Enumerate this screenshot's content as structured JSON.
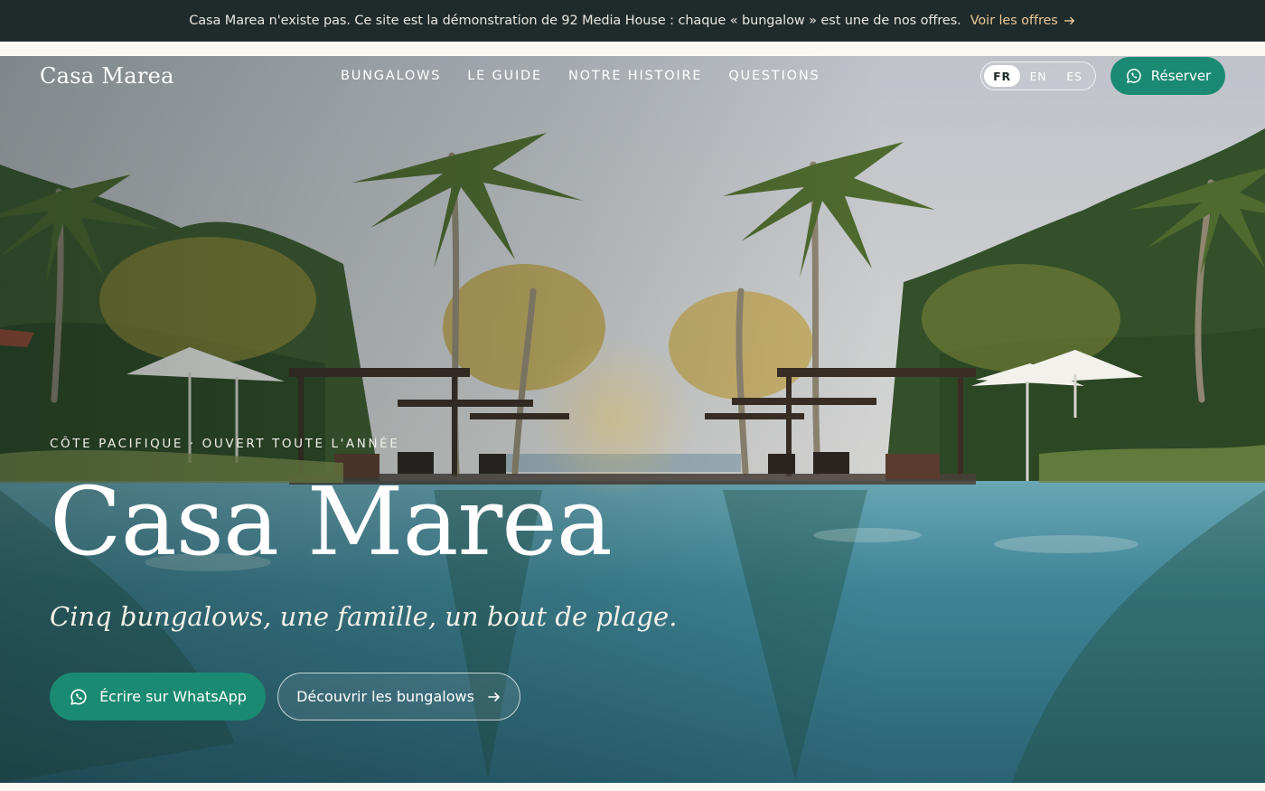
{
  "banner": {
    "message": "Casa Marea n'existe pas. Ce site est la démonstration de 92 Media House : chaque « bungalow » est une de nos offres.",
    "link_label": "Voir les offres",
    "link_icon": "arrow-right-icon"
  },
  "header": {
    "logo": "Casa Marea",
    "nav": [
      {
        "label": "BUNGALOWS"
      },
      {
        "label": "LE GUIDE"
      },
      {
        "label": "NOTRE HISTOIRE"
      },
      {
        "label": "QUESTIONS"
      }
    ],
    "languages": [
      {
        "code": "FR",
        "active": true
      },
      {
        "code": "EN",
        "active": false
      },
      {
        "code": "ES",
        "active": false
      }
    ],
    "reserve_label": "Réserver",
    "reserve_icon": "whatsapp-icon"
  },
  "hero": {
    "eyebrow": "CÔTE PACIFIQUE · OUVERT TOUTE L'ANNÉE",
    "title": "Casa Marea",
    "subtitle": "Cinq bungalows, une famille, un bout de plage.",
    "primary_cta": "Écrire sur WhatsApp",
    "secondary_cta": "Découvrir les bungalows"
  },
  "colors": {
    "banner_bg": "#1f2a2a",
    "banner_link": "#e7c796",
    "accent_green": "#1b8a72",
    "page_bg": "#fbf8f1"
  }
}
